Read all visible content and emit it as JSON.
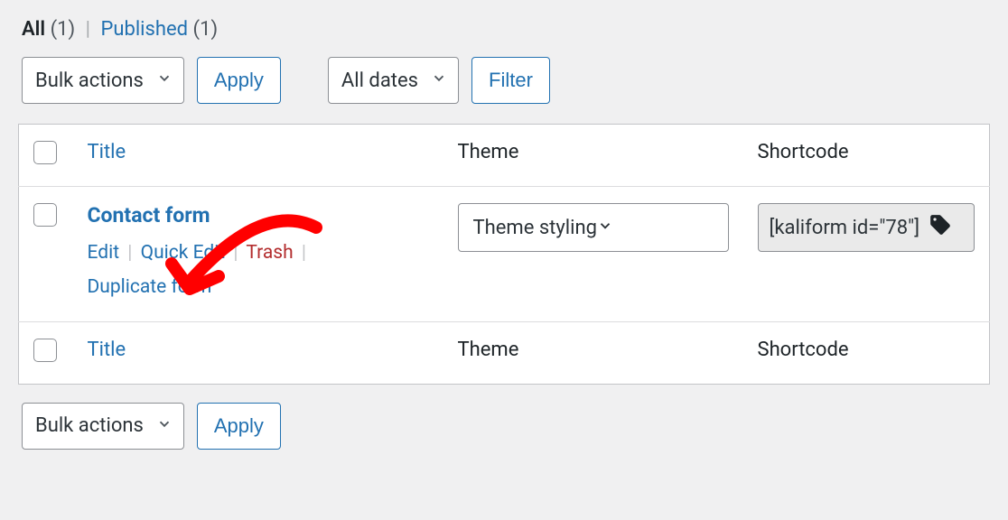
{
  "filters": {
    "all_label": "All",
    "all_count": "(1)",
    "published_label": "Published",
    "published_count": "(1)"
  },
  "actions": {
    "bulk_label": "Bulk actions",
    "apply_label": "Apply",
    "dates_label": "All dates",
    "filter_label": "Filter"
  },
  "columns": {
    "title": "Title",
    "theme": "Theme",
    "shortcode": "Shortcode"
  },
  "row": {
    "title": "Contact form",
    "edit": "Edit",
    "quick_edit": "Quick Edit",
    "trash": "Trash",
    "duplicate": "Duplicate form",
    "theme_value": "Theme styling",
    "shortcode_value": "[kaliform id=\"78\"]"
  }
}
